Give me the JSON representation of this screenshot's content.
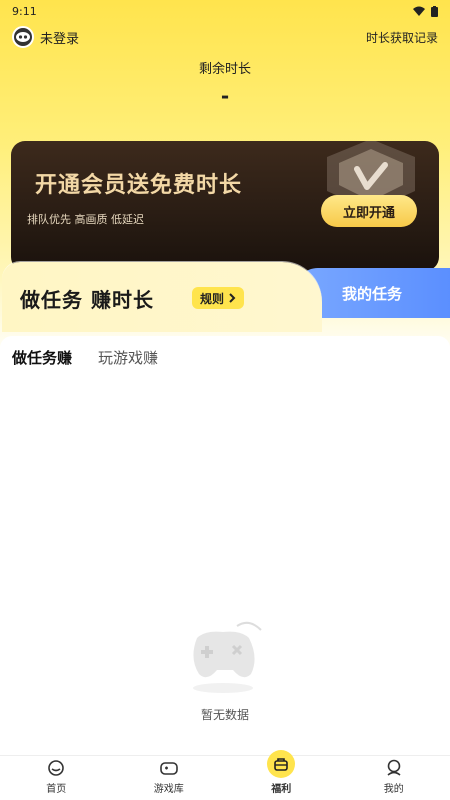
{
  "status_bar": {
    "time": "9:11"
  },
  "header": {
    "user_label": "未登录",
    "record_link": "时长获取记录"
  },
  "remaining": {
    "label": "剩余时长",
    "value": "-"
  },
  "vip_card": {
    "title": "开通会员送免费时长",
    "subtitle": "排队优先 高画质 低延迟",
    "button": "立即开通"
  },
  "task_banner": {
    "title": "做任务 赚时长",
    "rule_button": "规则",
    "my_task": "我的任务"
  },
  "tabs": [
    {
      "label": "做任务赚",
      "active": true
    },
    {
      "label": "玩游戏赚",
      "active": false
    }
  ],
  "empty_state": {
    "text": "暂无数据"
  },
  "bottom_nav": [
    {
      "label": "首页",
      "icon": "home-icon"
    },
    {
      "label": "游戏库",
      "icon": "gamepad-icon"
    },
    {
      "label": "福利",
      "icon": "gift-icon",
      "active": true
    },
    {
      "label": "我的",
      "icon": "profile-icon"
    }
  ],
  "colors": {
    "accent": "#ffe44d",
    "vip_bg": "#2a1d14",
    "my_task_blue": "#6b9bff"
  }
}
